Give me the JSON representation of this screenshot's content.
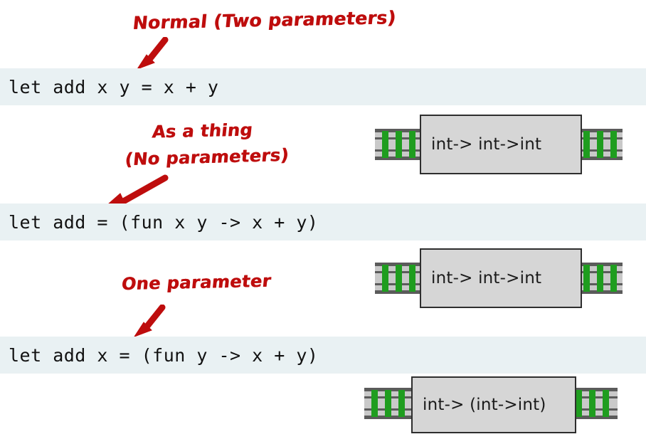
{
  "slide": {
    "title_topic": "OCaml function definition forms and their types",
    "background_color": "#ffffff",
    "annotation_color": "#be0d0d",
    "code_band_color": "#e9f1f3",
    "type_box_fill": "#d6d6d6",
    "type_box_border": "#2e2e2e",
    "rail_color": "#5b5b5b",
    "tie_color": "#1f9d1f"
  },
  "rows": [
    {
      "id": "row-normal",
      "annotation_lines": [
        "Normal (Two parameters)"
      ],
      "code": "let add x y = x + y",
      "type_signature": "int-> int->int"
    },
    {
      "id": "row-as-a-thing",
      "annotation_lines": [
        "As a thing",
        "(No parameters)"
      ],
      "code": "let add = (fun x y -> x + y)",
      "type_signature": "int-> int->int"
    },
    {
      "id": "row-one-parameter",
      "annotation_lines": [
        "One parameter"
      ],
      "code": "let add x = (fun y -> x + y)",
      "type_signature": "int-> (int->int)"
    }
  ]
}
